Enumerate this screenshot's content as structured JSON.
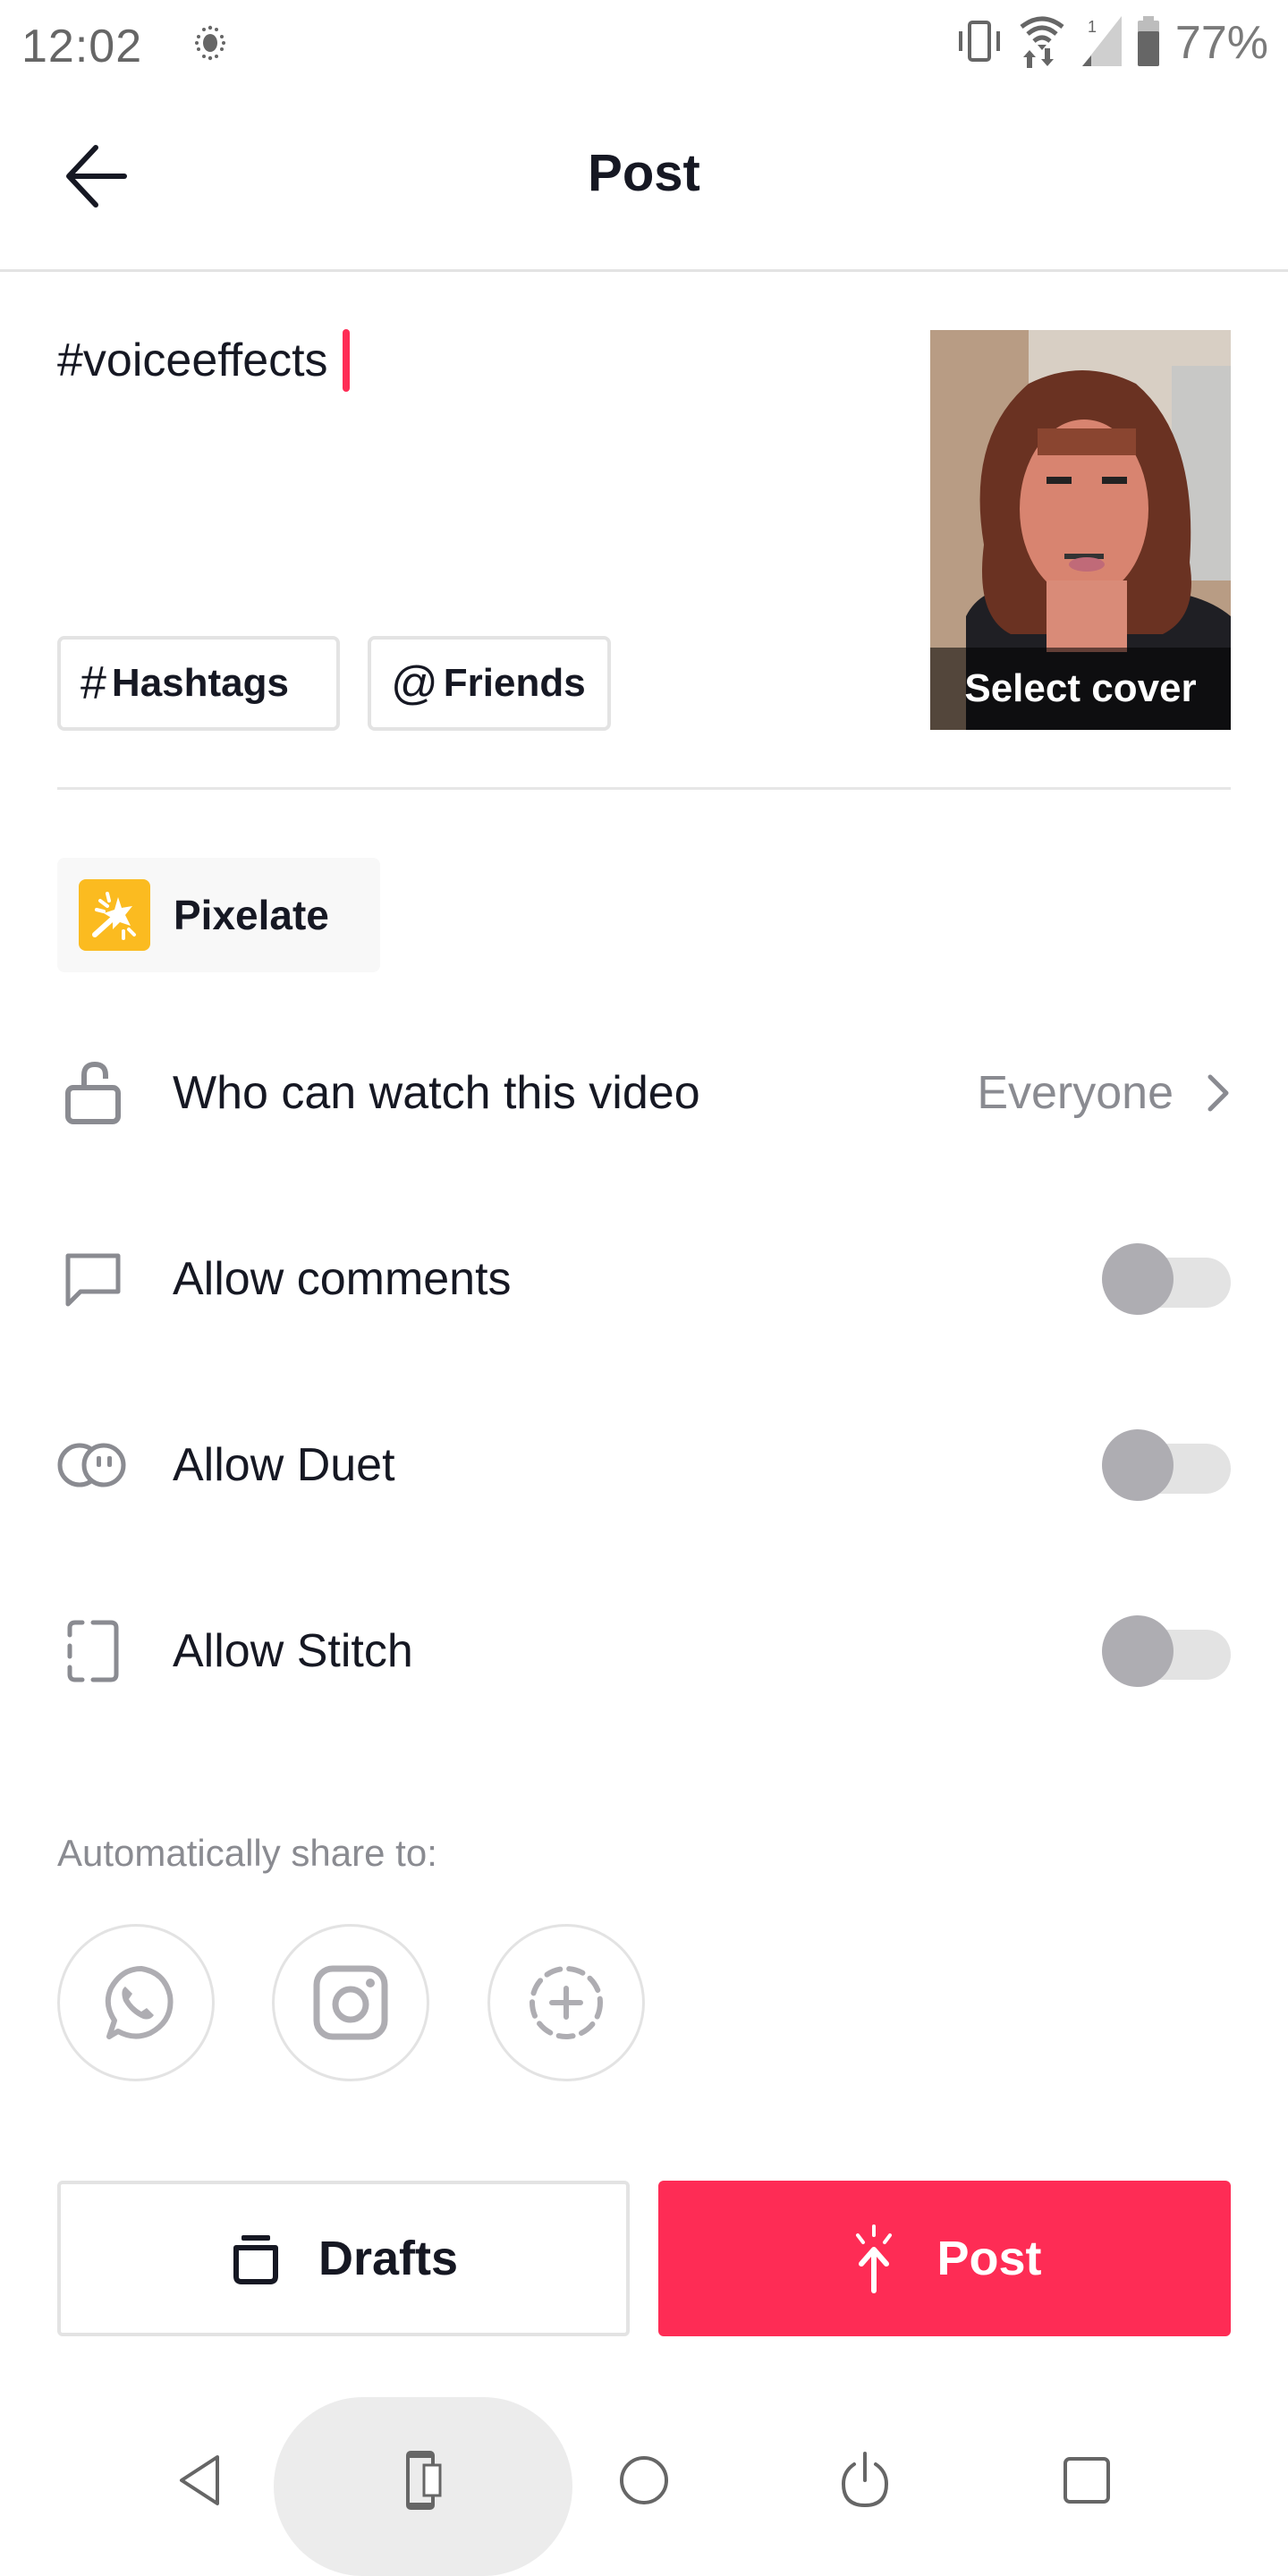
{
  "status_bar": {
    "time": "12:02",
    "battery_percent": "77%",
    "icons": [
      "brightness-icon",
      "vibrate-icon",
      "wifi-icon",
      "signal-icon",
      "battery-icon"
    ]
  },
  "header": {
    "title": "Post",
    "back_icon": "arrow-left-icon"
  },
  "caption": {
    "text": "#voiceeffects",
    "cursor_color": "#fe2c55"
  },
  "chips": {
    "hashtags": {
      "glyph": "#",
      "label": "Hashtags"
    },
    "friends": {
      "glyph": "@",
      "label": "Friends"
    }
  },
  "cover": {
    "label": "Select cover"
  },
  "effect": {
    "label": "Pixelate",
    "icon": "magic-wand-icon",
    "icon_color": "#fbbb20"
  },
  "settings": {
    "privacy": {
      "label": "Who can watch this video",
      "value": "Everyone",
      "icon": "unlock-icon"
    },
    "comments": {
      "label": "Allow comments",
      "icon": "comment-icon",
      "enabled": false
    },
    "duet": {
      "label": "Allow Duet",
      "icon": "duet-icon",
      "enabled": false
    },
    "stitch": {
      "label": "Allow Stitch",
      "icon": "stitch-icon",
      "enabled": false
    }
  },
  "share": {
    "label": "Automatically share to:",
    "targets": [
      "whatsapp-icon",
      "instagram-icon",
      "add-story-icon"
    ]
  },
  "actions": {
    "drafts_label": "Drafts",
    "post_label": "Post",
    "post_color": "#fe2c55"
  },
  "nav_bar": {
    "buttons": [
      "back-icon",
      "rotate-icon",
      "home-icon",
      "power-icon",
      "recents-icon"
    ]
  }
}
